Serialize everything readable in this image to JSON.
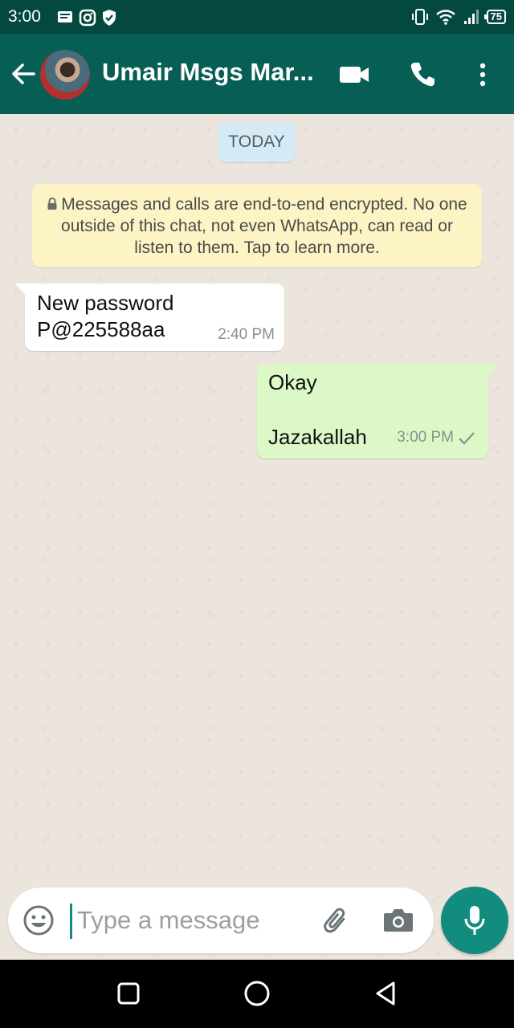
{
  "status_bar": {
    "time": "3:00",
    "battery": "75",
    "left_icons": [
      "notification-icon",
      "instagram-icon",
      "shield-icon"
    ],
    "right_icons": [
      "vibrate-icon",
      "wifi-icon",
      "signal-icon",
      "battery-icon"
    ]
  },
  "header": {
    "title": "Umair Msgs Mar...",
    "icons": [
      "back-arrow-icon",
      "avatar",
      "video-call-icon",
      "phone-icon",
      "more-vert-icon"
    ]
  },
  "chat": {
    "date_chip": "TODAY",
    "encryption_notice": "Messages and calls are end-to-end encrypted. No one outside of this chat, not even WhatsApp, can read or listen to them. Tap to learn more.",
    "messages": [
      {
        "direction": "incoming",
        "text": "New password\nP@225588aa",
        "time": "2:40 PM"
      },
      {
        "direction": "outgoing",
        "text": "Okay\n\nJazakallah",
        "time": "3:00 PM",
        "status": "sent"
      }
    ]
  },
  "composer": {
    "placeholder": "Type a message",
    "value": ""
  },
  "colors": {
    "header": "#075e54",
    "status_bar": "#04493f",
    "accent": "#128c7e",
    "outgoing_bubble": "#dcf8c6",
    "incoming_bubble": "#ffffff",
    "notice_bg": "#fcf4c4",
    "date_chip_bg": "#d4eaf4",
    "chat_bg": "#ece5dd"
  }
}
